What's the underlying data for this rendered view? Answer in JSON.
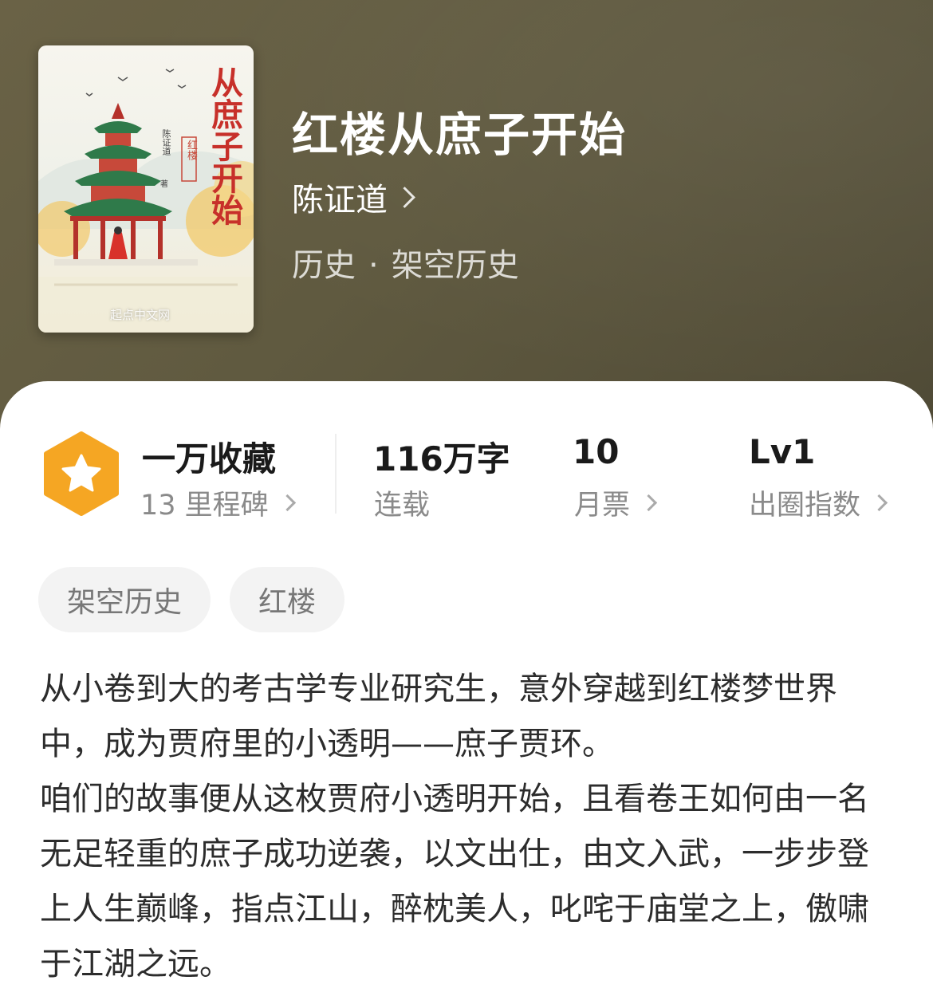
{
  "book": {
    "title": "红楼从庶子开始",
    "author": "陈证道",
    "category": "历史",
    "subcategory": "架空历史",
    "category_separator": "·"
  },
  "cover": {
    "title_text": "从庶子开始",
    "series_text": "红楼",
    "author_text": "陈证道",
    "author_suffix": "著",
    "publisher_watermark": "起点中文网"
  },
  "stats": {
    "collection": {
      "value": "一万收藏",
      "sub": "13 里程碑",
      "icon": "star-icon"
    },
    "words": {
      "value": "116万字",
      "sub": "连载"
    },
    "monthly_ticket": {
      "value": "10",
      "sub": "月票"
    },
    "popularity": {
      "value": "Lv1",
      "sub": "出圈指数"
    }
  },
  "tags": [
    "架空历史",
    "红楼"
  ],
  "description": [
    "从小卷到大的考古学专业研究生，意外穿越到红楼梦世界中，成为贾府里的小透明——庶子贾环。",
    "咱们的故事便从这枚贾府小透明开始，且看卷王如何由一名无足轻重的庶子成功逆袭，以文出仕，由文入武，一步步登上人生巅峰，指点江山，醉枕美人，叱咤于庙堂之上，傲啸于江湖之远。"
  ],
  "colors": {
    "header_bg": "#635c43",
    "badge_orange": "#f5a623",
    "text_primary": "#1a1a1a",
    "text_secondary": "#8a8a8a",
    "tag_bg": "#f3f3f3"
  }
}
